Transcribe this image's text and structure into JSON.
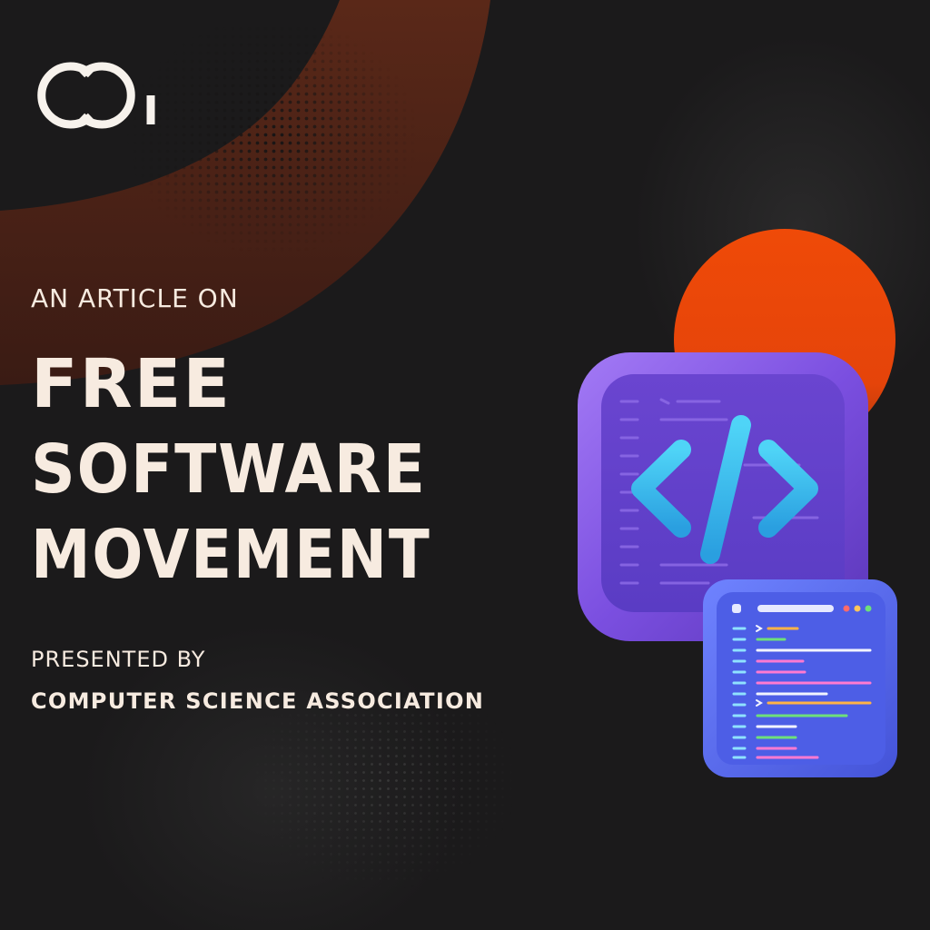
{
  "logo": {
    "icon": "ca-monogram-logo",
    "text": "CA"
  },
  "headline": {
    "kicker": "AN ARTICLE ON",
    "title_lines": [
      "FREE",
      "SOFTWARE",
      "MOVEMENT"
    ]
  },
  "credit": {
    "label": "PRESENTED BY",
    "organization": "COMPUTER SCIENCE ASSOCIATION"
  },
  "illustration": {
    "icons": [
      "code-brackets-icon",
      "code-editor-window-icon"
    ]
  },
  "colors": {
    "background": "#1b1a1b",
    "text": "#f7ebe0",
    "accent_orange": "#ef4a08",
    "swoosh_brown": "#4a2116",
    "icon_purple": "#7b4fe0",
    "icon_blue": "#5a6cf0",
    "code_cyan": "#3cc2f2"
  }
}
